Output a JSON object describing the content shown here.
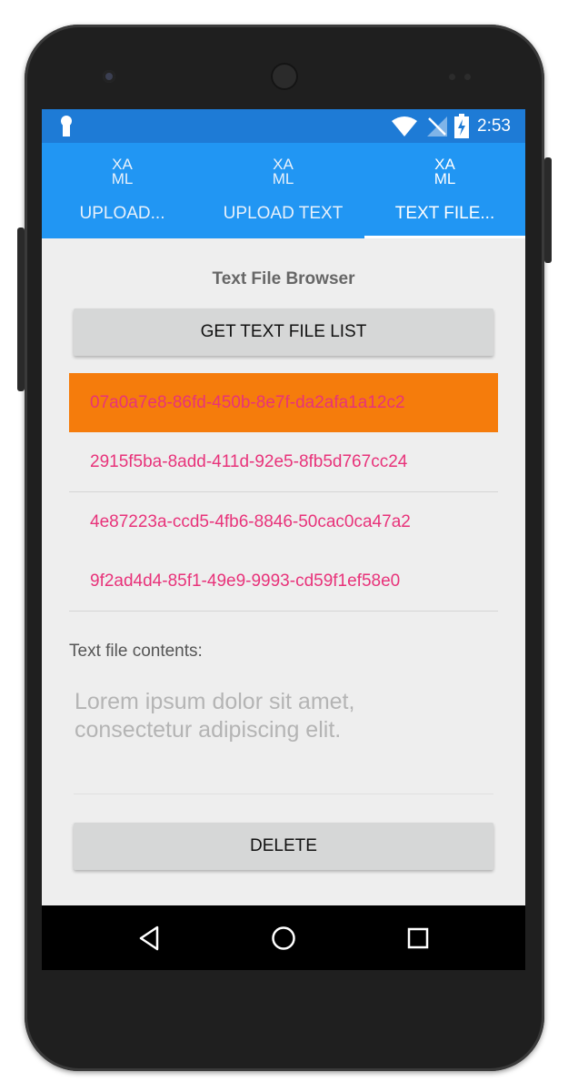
{
  "status_bar": {
    "time": "2:53"
  },
  "tabs": [
    {
      "icon_text_top": "XA",
      "icon_text_bottom": "ML",
      "label": "UPLOAD..."
    },
    {
      "icon_text_top": "XA",
      "icon_text_bottom": "ML",
      "label": "UPLOAD TEXT"
    },
    {
      "icon_text_top": "XA",
      "icon_text_bottom": "ML",
      "label": "TEXT FILE..."
    }
  ],
  "selected_tab_index": 2,
  "main": {
    "title": "Text File Browser",
    "get_list_button": "GET TEXT FILE LIST",
    "files": [
      "07a0a7e8-86fd-450b-8e7f-da2afa1a12c2",
      "2915f5ba-8add-411d-92e5-8fb5d767cc24",
      "4e87223a-ccd5-4fb6-8846-50cac0ca47a2",
      "9f2ad4d4-85f1-49e9-9993-cd59f1ef58e0"
    ],
    "selected_file_index": 0,
    "contents_label": "Text file contents:",
    "contents_placeholder_line1": "Lorem ipsum dolor sit amet,",
    "contents_placeholder_line2": "consectetur adipiscing elit.",
    "delete_button": "DELETE"
  },
  "colors": {
    "tab_bar": "#2196f3",
    "status_bar": "#1e7bd6",
    "selected_row": "#f57c0c",
    "file_text": "#e8337a"
  },
  "icons": [
    "keyhole-icon",
    "wifi-icon",
    "no-sim-icon",
    "battery-charging-icon",
    "back-icon",
    "home-icon",
    "recents-icon"
  ]
}
